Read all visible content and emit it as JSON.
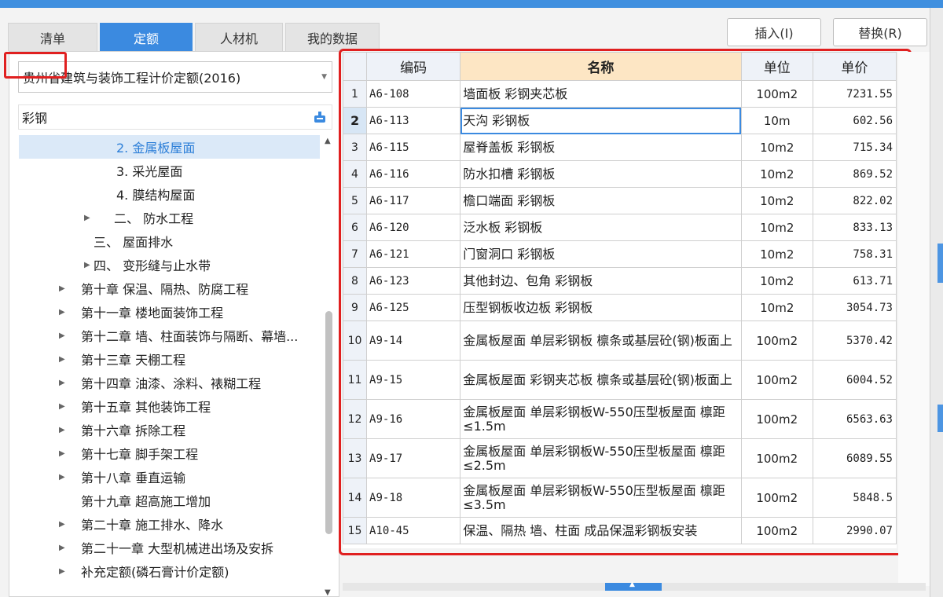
{
  "tabs": [
    {
      "label": "清单",
      "active": false
    },
    {
      "label": "定额",
      "active": true
    },
    {
      "label": "人材机",
      "active": false
    },
    {
      "label": "我的数据",
      "active": false
    }
  ],
  "actions": {
    "insert_label": "插入(I)",
    "replace_label": "替换(R)"
  },
  "library_select": {
    "value": "贵州省建筑与装饰工程计价定额(2016)"
  },
  "search": {
    "value": "彩钢"
  },
  "tree": [
    {
      "label": "2. 金属板屋面",
      "expandable": false,
      "selected": true
    },
    {
      "label": "3. 采光屋面",
      "expandable": false,
      "selected": false
    },
    {
      "label": "4. 膜结构屋面",
      "expandable": false,
      "selected": false
    },
    {
      "label": "二、 防水工程",
      "expandable": true,
      "selected": false
    },
    {
      "label": "三、 屋面排水",
      "expandable": false,
      "selected": false
    },
    {
      "label": "四、 变形缝与止水带",
      "expandable": true,
      "selected": false
    },
    {
      "label": "第十章 保温、隔热、防腐工程",
      "expandable": true,
      "selected": false
    },
    {
      "label": "第十一章 楼地面装饰工程",
      "expandable": true,
      "selected": false
    },
    {
      "label": "第十二章 墙、柱面装饰与隔断、幕墙...",
      "expandable": true,
      "selected": false
    },
    {
      "label": "第十三章 天棚工程",
      "expandable": true,
      "selected": false
    },
    {
      "label": "第十四章 油漆、涂料、裱糊工程",
      "expandable": true,
      "selected": false
    },
    {
      "label": "第十五章 其他装饰工程",
      "expandable": true,
      "selected": false
    },
    {
      "label": "第十六章 拆除工程",
      "expandable": true,
      "selected": false
    },
    {
      "label": "第十七章 脚手架工程",
      "expandable": true,
      "selected": false
    },
    {
      "label": "第十八章 垂直运输",
      "expandable": true,
      "selected": false
    },
    {
      "label": "第十九章 超高施工增加",
      "expandable": false,
      "selected": false
    },
    {
      "label": "第二十章 施工排水、降水",
      "expandable": true,
      "selected": false
    },
    {
      "label": "第二十一章 大型机械进出场及安拆",
      "expandable": true,
      "selected": false
    },
    {
      "label": "补充定额(磷石膏计价定额)",
      "expandable": true,
      "selected": false
    }
  ],
  "table": {
    "headers": {
      "code": "编码",
      "name": "名称",
      "unit": "单位",
      "price": "单价"
    },
    "current_row": 2,
    "rows": [
      {
        "no": "1",
        "code": "A6-108",
        "name": "墙面板 彩钢夹芯板",
        "unit": "100m2",
        "price": "7231.55"
      },
      {
        "no": "2",
        "code": "A6-113",
        "name": "天沟 彩钢板",
        "unit": "10m",
        "price": "602.56"
      },
      {
        "no": "3",
        "code": "A6-115",
        "name": "屋脊盖板 彩钢板",
        "unit": "10m2",
        "price": "715.34"
      },
      {
        "no": "4",
        "code": "A6-116",
        "name": "防水扣槽 彩钢板",
        "unit": "10m2",
        "price": "869.52"
      },
      {
        "no": "5",
        "code": "A6-117",
        "name": "檐口端面 彩钢板",
        "unit": "10m2",
        "price": "822.02"
      },
      {
        "no": "6",
        "code": "A6-120",
        "name": "泛水板 彩钢板",
        "unit": "10m2",
        "price": "833.13"
      },
      {
        "no": "7",
        "code": "A6-121",
        "name": "门窗洞口 彩钢板",
        "unit": "10m2",
        "price": "758.31"
      },
      {
        "no": "8",
        "code": "A6-123",
        "name": "其他封边、包角 彩钢板",
        "unit": "10m2",
        "price": "613.71"
      },
      {
        "no": "9",
        "code": "A6-125",
        "name": "压型钢板收边板 彩钢板",
        "unit": "10m2",
        "price": "3054.73"
      },
      {
        "no": "10",
        "code": "A9-14",
        "name": "金属板屋面 单层彩钢板 檩条或基层砼(钢)板面上",
        "unit": "100m2",
        "price": "5370.42"
      },
      {
        "no": "11",
        "code": "A9-15",
        "name": "金属板屋面 彩钢夹芯板 檩条或基层砼(钢)板面上",
        "unit": "100m2",
        "price": "6004.52"
      },
      {
        "no": "12",
        "code": "A9-16",
        "name": "金属板屋面 单层彩钢板W-550压型板屋面 檩距≤1.5m",
        "unit": "100m2",
        "price": "6563.63"
      },
      {
        "no": "13",
        "code": "A9-17",
        "name": "金属板屋面 单层彩钢板W-550压型板屋面 檩距≤2.5m",
        "unit": "100m2",
        "price": "6089.55"
      },
      {
        "no": "14",
        "code": "A9-18",
        "name": "金属板屋面 单层彩钢板W-550压型板屋面 檩距≤3.5m",
        "unit": "100m2",
        "price": "5848.5"
      },
      {
        "no": "15",
        "code": "A10-45",
        "name": "保温、隔热 墙、柱面 成品保温彩钢板安装",
        "unit": "100m2",
        "price": "2990.07"
      }
    ]
  },
  "colors": {
    "accent": "#3b8ae0",
    "highlight": "#e02020",
    "name_header": "#fde6c4"
  }
}
